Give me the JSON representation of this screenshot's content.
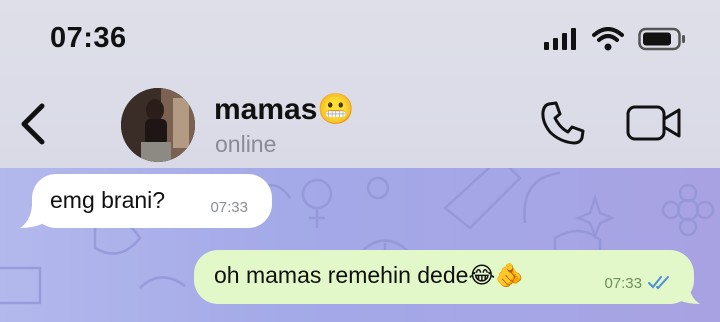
{
  "status_bar": {
    "time": "07:36",
    "icons": [
      "signal-icon",
      "wifi-icon",
      "battery-icon"
    ]
  },
  "header": {
    "contact_name": "mamas😬",
    "contact_status": "online",
    "icons": [
      "back-icon",
      "avatar",
      "phone-icon",
      "video-camera-icon"
    ]
  },
  "messages": [
    {
      "direction": "incoming",
      "text": "emg brani?",
      "time": "07:33"
    },
    {
      "direction": "outgoing",
      "text": "oh mamas remehin dede😂🫵",
      "time": "07:33",
      "status": "read"
    }
  ],
  "colors": {
    "header_bg": "#dedfe9",
    "chat_bg": "#a5a6e6",
    "incoming_bubble": "#ffffff",
    "outgoing_bubble": "#e3f8c9",
    "read_ticks": "#4a8fd6"
  }
}
